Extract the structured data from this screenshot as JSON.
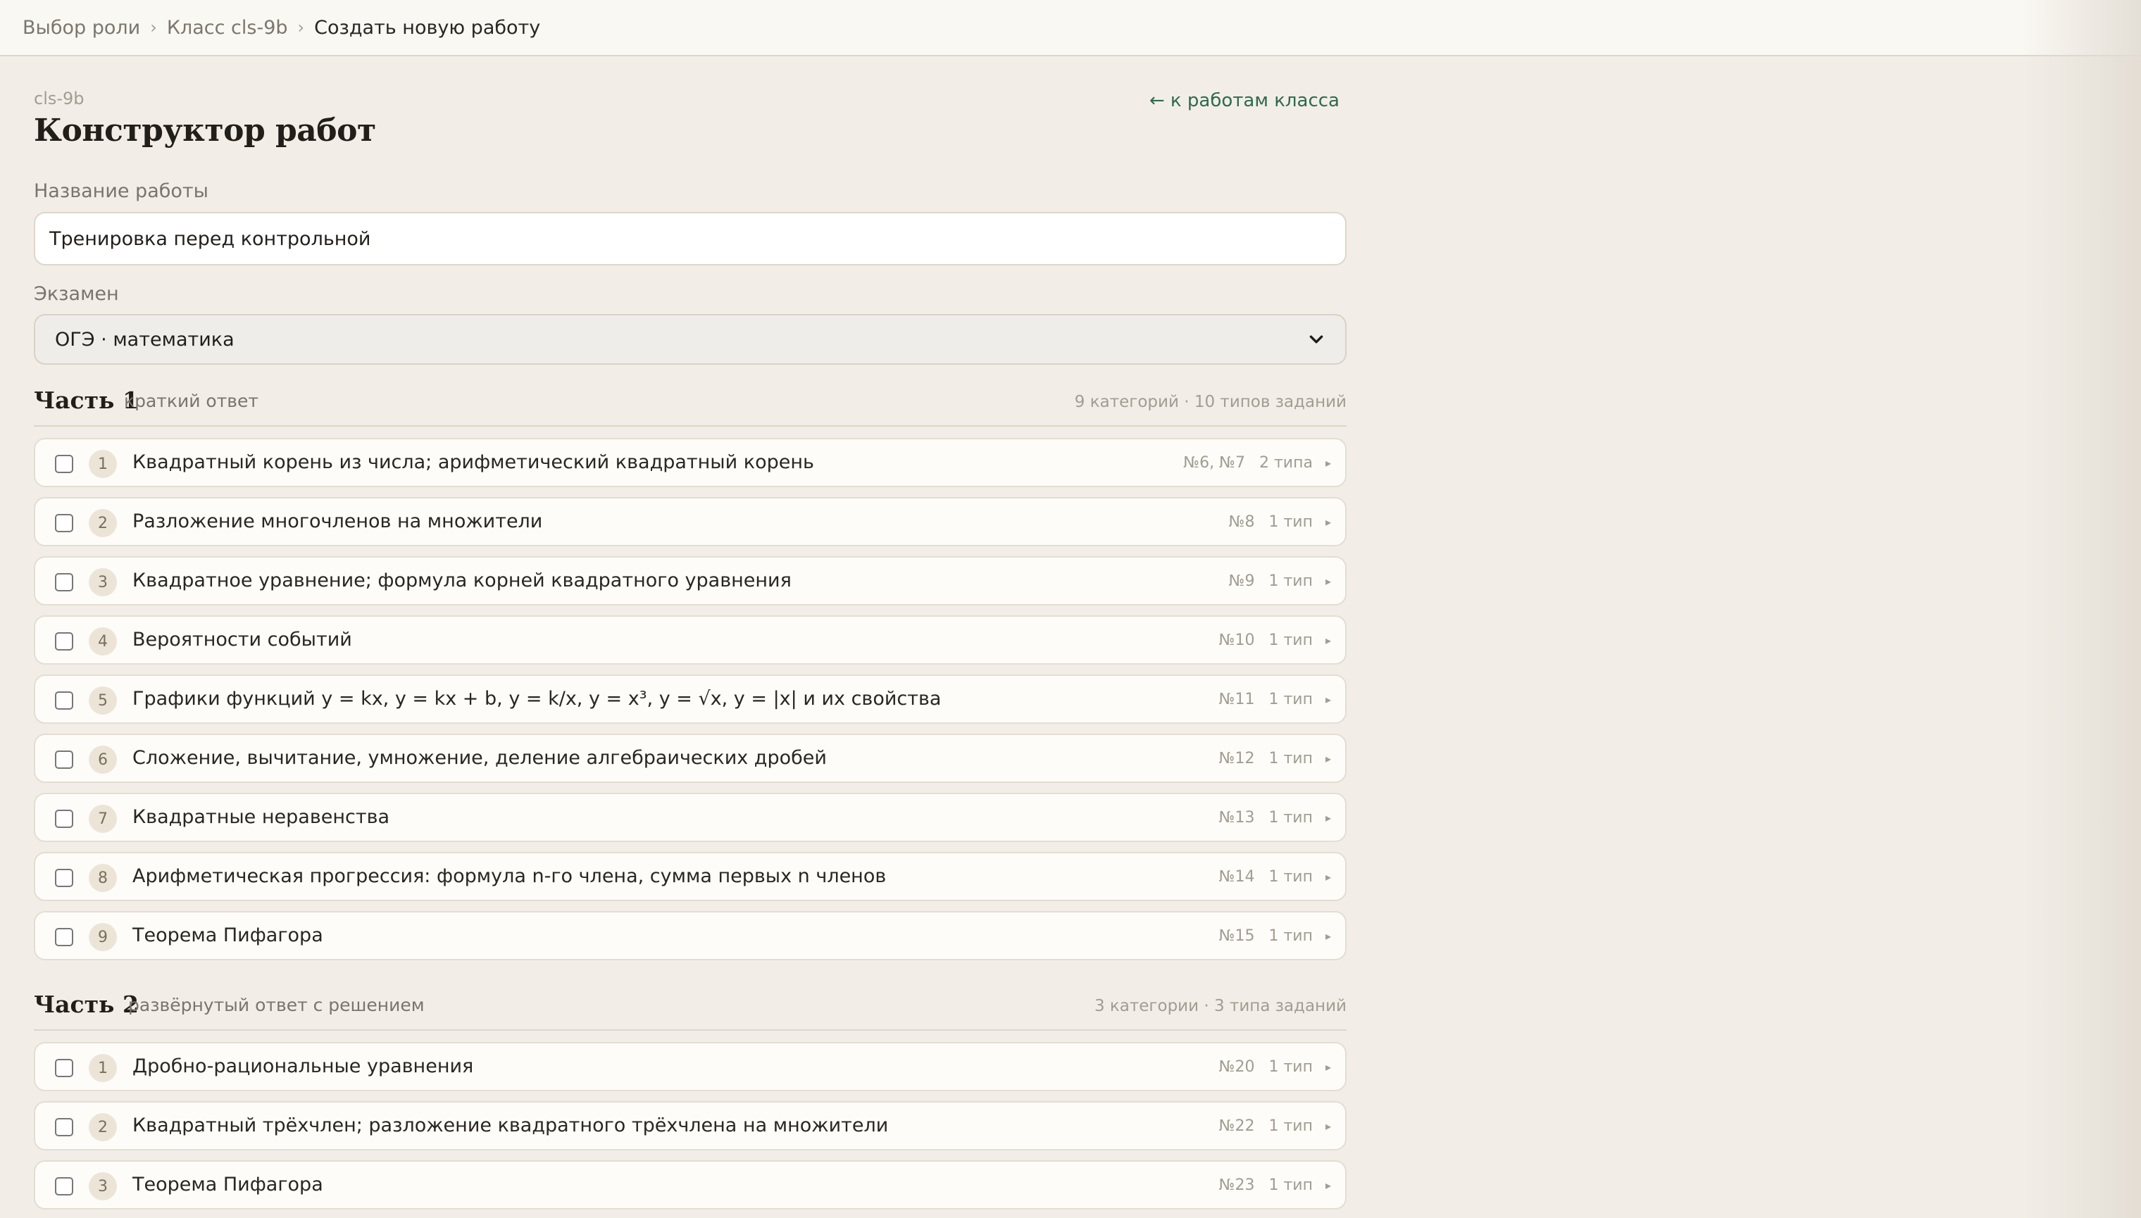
{
  "breadcrumb": {
    "items": [
      "Выбор роли",
      "Класс cls-9b"
    ],
    "current": "Создать новую работу",
    "separator_icon": "chevron-right-icon"
  },
  "header": {
    "class_code": "cls-9b",
    "title": "Конструктор работ",
    "back_link": "← к работам класса"
  },
  "form": {
    "title_label": "Название работы",
    "title_value": "Тренировка перед контрольной",
    "exam_label": "Экзамен",
    "exam_value": "ОГЭ · математика",
    "exam_icon": "chevron-down-icon"
  },
  "parts": [
    {
      "title": "Часть 1",
      "subtitle": "краткий ответ",
      "stats": "9 категорий · 10 типов заданий",
      "categories": [
        {
          "num": "1",
          "name": "Квадратный корень из числа; арифметический квадратный корень",
          "tasks": "№6, №7",
          "types": "2 типа",
          "arrow": "▸"
        },
        {
          "num": "2",
          "name": "Разложение многочленов на множители",
          "tasks": "№8",
          "types": "1 тип",
          "arrow": "▸"
        },
        {
          "num": "3",
          "name": "Квадратное уравнение; формула корней квадратного уравнения",
          "tasks": "№9",
          "types": "1 тип",
          "arrow": "▸"
        },
        {
          "num": "4",
          "name": "Вероятности событий",
          "tasks": "№10",
          "types": "1 тип",
          "arrow": "▸"
        },
        {
          "num": "5",
          "name": "Графики функций y = kx, y = kx + b, y = k/x, y = x³, y = √x, y = |x| и их свойства",
          "tasks": "№11",
          "types": "1 тип",
          "arrow": "▸"
        },
        {
          "num": "6",
          "name": "Сложение, вычитание, умножение, деление алгебраических дробей",
          "tasks": "№12",
          "types": "1 тип",
          "arrow": "▸"
        },
        {
          "num": "7",
          "name": "Квадратные неравенства",
          "tasks": "№13",
          "types": "1 тип",
          "arrow": "▸"
        },
        {
          "num": "8",
          "name": "Арифметическая прогрессия: формула n-го члена, сумма первых n членов",
          "tasks": "№14",
          "types": "1 тип",
          "arrow": "▸"
        },
        {
          "num": "9",
          "name": "Теорема Пифагора",
          "tasks": "№15",
          "types": "1 тип",
          "arrow": "▸"
        }
      ]
    },
    {
      "title": "Часть 2",
      "subtitle": "развёрнутый ответ с решением",
      "stats": "3 категории · 3 типа заданий",
      "categories": [
        {
          "num": "1",
          "name": "Дробно-рациональные уравнения",
          "tasks": "№20",
          "types": "1 тип",
          "arrow": "▸"
        },
        {
          "num": "2",
          "name": "Квадратный трёхчлен; разложение квадратного трёхчлена на множители",
          "tasks": "№22",
          "types": "1 тип",
          "arrow": "▸"
        },
        {
          "num": "3",
          "name": "Теорема Пифагора",
          "tasks": "№23",
          "types": "1 тип",
          "arrow": "▸"
        }
      ]
    }
  ]
}
